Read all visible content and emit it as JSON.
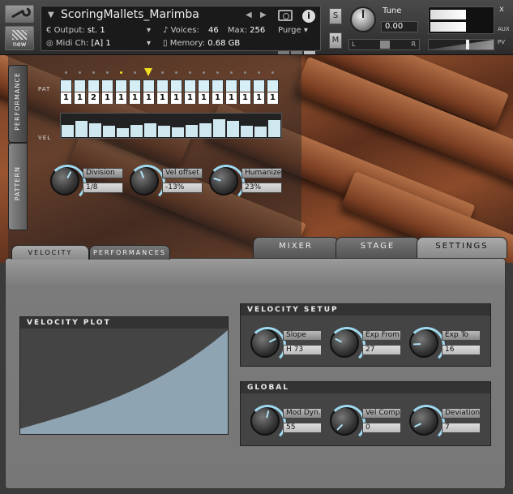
{
  "header": {
    "instrument_title": "ScoringMallets_Marimba",
    "output_label": "Output:",
    "output_value": "st. 1",
    "midi_label": "Midi Ch:",
    "midi_value": "[A]  1",
    "voices_label": "Voices:",
    "voices_value": "46",
    "max_label": "Max:",
    "max_value": "256",
    "memory_label": "Memory:",
    "memory_value": "0.68 GB",
    "purge_label": "Purge",
    "new_label": "new",
    "s_label": "S",
    "m_label": "M",
    "tune_label": "Tune",
    "tune_value": "0.00",
    "pan_left": "L",
    "pan_right": "R",
    "aux_label": "AUX",
    "pv_label": "PV",
    "close_label": "x"
  },
  "side_tabs": {
    "performance": "PERFORMANCE",
    "pattern": "PATTERN"
  },
  "pattern": {
    "pat_label": "PAT",
    "vel_label": "VEL",
    "steps": [
      "1",
      "1",
      "2",
      "1",
      "1",
      "1",
      "1",
      "1",
      "1",
      "1",
      "1",
      "1",
      "1",
      "1",
      "1",
      "1"
    ],
    "velocity_levels": [
      0.55,
      0.7,
      0.62,
      0.5,
      0.4,
      0.55,
      0.6,
      0.5,
      0.42,
      0.55,
      0.6,
      0.8,
      0.7,
      0.5,
      0.45,
      0.75
    ],
    "current_step": 6
  },
  "perf_knobs": [
    {
      "name": "Division",
      "value": "1/8",
      "level": 0.6
    },
    {
      "name": "Vel offset",
      "value": "-13%",
      "level": 0.42
    },
    {
      "name": "Humanize",
      "value": "23%",
      "level": 0.23
    }
  ],
  "tabs": {
    "mixer": "MIXER",
    "stage": "STAGE",
    "settings": "SETTINGS",
    "velocity": "VELOCITY",
    "performances": "PERFORMANCES"
  },
  "velocity_plot": {
    "title": "VELOCITY PLOT"
  },
  "velocity_setup": {
    "title": "VELOCITY SETUP",
    "knobs": [
      {
        "name": "Slope",
        "value": "H 73",
        "level": 0.73
      },
      {
        "name": "Exp From",
        "value": "27",
        "level": 0.27
      },
      {
        "name": "Exp To",
        "value": "16",
        "level": 0.16
      }
    ]
  },
  "global": {
    "title": "GLOBAL",
    "knobs": [
      {
        "name": "Mod Dyn.",
        "value": "55",
        "level": 0.55
      },
      {
        "name": "Vel Comp",
        "value": "0",
        "level": 0.0
      },
      {
        "name": "Deviation",
        "value": "7",
        "level": 0.07
      }
    ]
  },
  "colors": {
    "accent": "#9fd9f0",
    "step_marker": "#f0e020",
    "plot_fill": "#8fa4b2"
  }
}
